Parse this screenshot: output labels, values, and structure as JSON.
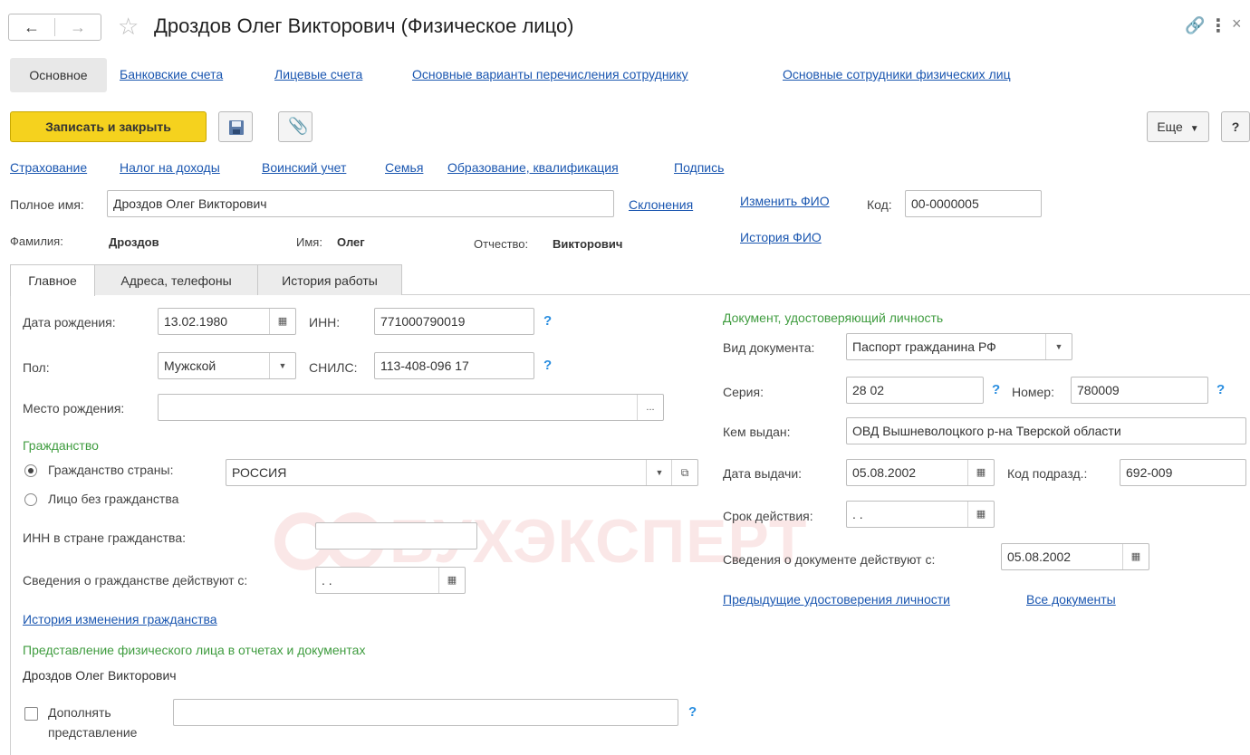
{
  "window": {
    "title": "Дроздов Олег Викторович (Физическое лицо)"
  },
  "top_tabs": [
    {
      "label": "Основное",
      "active": true
    },
    {
      "label": "Банковские счета"
    },
    {
      "label": "Лицевые счета"
    },
    {
      "label": "Основные варианты перечисления сотруднику"
    },
    {
      "label": "Основные сотрудники физических лиц"
    }
  ],
  "toolbar": {
    "save_close": "Записать и закрыть",
    "more": "Еще",
    "help": "?"
  },
  "links_row": [
    "Страхование",
    "Налог на доходы",
    "Воинский учет",
    "Семья",
    "Образование, квалификация",
    "Подпись"
  ],
  "header": {
    "full_name_label": "Полное имя:",
    "full_name_value": "Дроздов Олег Викторович",
    "declensions_link": "Склонения",
    "change_fio_link": "Изменить ФИО",
    "code_label": "Код:",
    "code_value": "00-0000005",
    "surname_label": "Фамилия:",
    "surname_value": "Дроздов",
    "name_label": "Имя:",
    "name_value": "Олег",
    "patronymic_label": "Отчество:",
    "patronymic_value": "Викторович",
    "fio_history_link": "История ФИО"
  },
  "inner_tabs": [
    {
      "label": "Главное",
      "active": true
    },
    {
      "label": "Адреса, телефоны"
    },
    {
      "label": "История работы"
    }
  ],
  "left": {
    "birth_date_label": "Дата рождения:",
    "birth_date_value": "13.02.1980",
    "inn_label": "ИНН:",
    "inn_value": "771000790019",
    "gender_label": "Пол:",
    "gender_value": "Мужской",
    "snils_label": "СНИЛС:",
    "snils_value": "113-408-096 17",
    "birth_place_label": "Место рождения:",
    "birth_place_value": "",
    "birth_place_btn": "...",
    "citizenship_title": "Гражданство",
    "citizen_country_label": "Гражданство страны:",
    "citizen_country_value": "РОССИЯ",
    "stateless_label": "Лицо без гражданства",
    "inn_country_label": "ИНН в стране гражданства:",
    "inn_country_value": "",
    "citizenship_from_label": "Сведения о гражданстве действуют с:",
    "citizenship_from_value": " .  .",
    "citizenship_history_link": "История изменения гражданства",
    "representation_title": "Представление физического лица в отчетах и документах",
    "representation_value": "Дроздов Олег Викторович",
    "supplement_label_1": "Дополнять",
    "supplement_label_2": "представление",
    "supplement_value": "",
    "q": "?"
  },
  "right": {
    "doc_title": "Документ, удостоверяющий личность",
    "doc_type_label": "Вид документа:",
    "doc_type_value": "Паспорт гражданина РФ",
    "series_label": "Серия:",
    "series_value": "28 02",
    "number_label": "Номер:",
    "number_value": "780009",
    "issued_by_label": "Кем выдан:",
    "issued_by_value": "ОВД Вышневолоцкого р-на Тверской области",
    "issue_date_label": "Дата выдачи:",
    "issue_date_value": "05.08.2002",
    "dept_code_label": "Код подразд.:",
    "dept_code_value": "692-009",
    "valid_until_label": "Срок действия:",
    "valid_until_value": " .  .",
    "doc_from_label": "Сведения о документе действуют с:",
    "doc_from_value": "05.08.2002",
    "prev_docs_link": "Предыдущие удостоверения личности",
    "all_docs_link": "Все документы",
    "q": "?"
  },
  "watermark": "БУХЭКСПЕРТ",
  "colors": {
    "link": "#1a56b0",
    "green": "#3f9c3f",
    "primary_button": "#f5d21e",
    "question": "#2a8ee0"
  }
}
